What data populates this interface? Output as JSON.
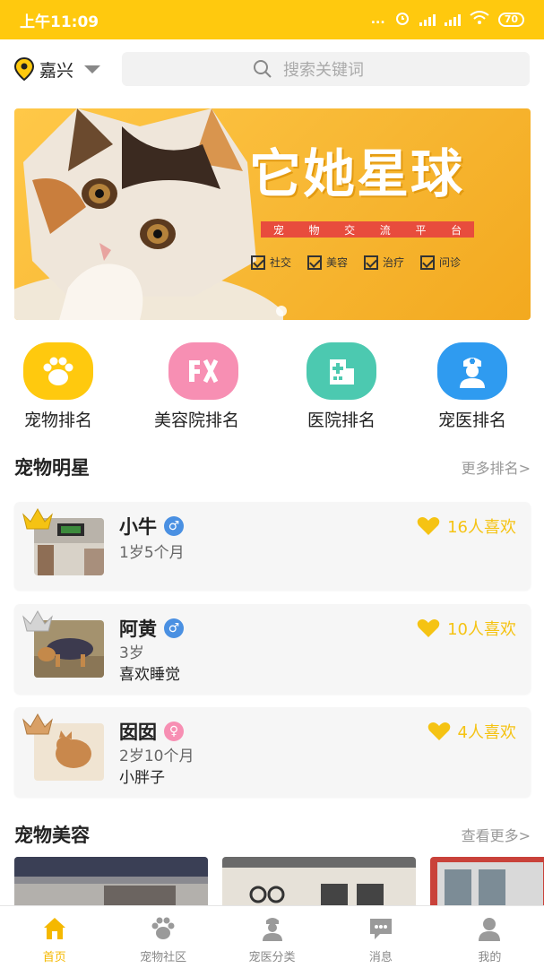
{
  "status_bar": {
    "time": "上午11:09",
    "dots": "...",
    "battery": "70"
  },
  "header": {
    "city": "嘉兴",
    "search_placeholder": "搜索关键词"
  },
  "banner": {
    "title": "它她星球",
    "subtitle_chars": [
      "宠",
      "物",
      "交",
      "流",
      "平",
      "台"
    ],
    "tags": [
      "社交",
      "美容",
      "治疗",
      "问诊"
    ]
  },
  "categories": [
    {
      "label": "宠物排名",
      "icon": "paw-icon",
      "color": "#FFC90E"
    },
    {
      "label": "美容院排名",
      "icon": "salon-icon",
      "color": "#F78FB3"
    },
    {
      "label": "医院排名",
      "icon": "hospital-icon",
      "color": "#4CC9B0"
    },
    {
      "label": "宠医排名",
      "icon": "nurse-icon",
      "color": "#2F9BF0"
    }
  ],
  "stars_section": {
    "title": "宠物明星",
    "more": "更多排名>"
  },
  "pets": [
    {
      "name": "小牛",
      "gender": "♂",
      "gender_color": "#4A90E2",
      "age": "1岁5个月",
      "desc": "",
      "likes": "16人喜欢",
      "crown_color": "#F5C313"
    },
    {
      "name": "阿黄",
      "gender": "♂",
      "gender_color": "#4A90E2",
      "age": "3岁",
      "desc": "喜欢睡觉",
      "likes": "10人喜欢",
      "crown_color": "#C8C8C8"
    },
    {
      "name": "囡囡",
      "gender": "♀",
      "gender_color": "#F78FB3",
      "age": "2岁10个月",
      "desc": "小胖子",
      "likes": "4人喜欢",
      "crown_color": "#D9A066"
    }
  ],
  "beauty_section": {
    "title": "宠物美容",
    "more": "查看更多>"
  },
  "tabs": [
    {
      "label": "首页",
      "icon": "home-icon",
      "active": true
    },
    {
      "label": "宠物社区",
      "icon": "paw-icon",
      "active": false
    },
    {
      "label": "宠医分类",
      "icon": "doctor-icon",
      "active": false
    },
    {
      "label": "消息",
      "icon": "message-icon",
      "active": false
    },
    {
      "label": "我的",
      "icon": "user-icon",
      "active": false
    }
  ]
}
